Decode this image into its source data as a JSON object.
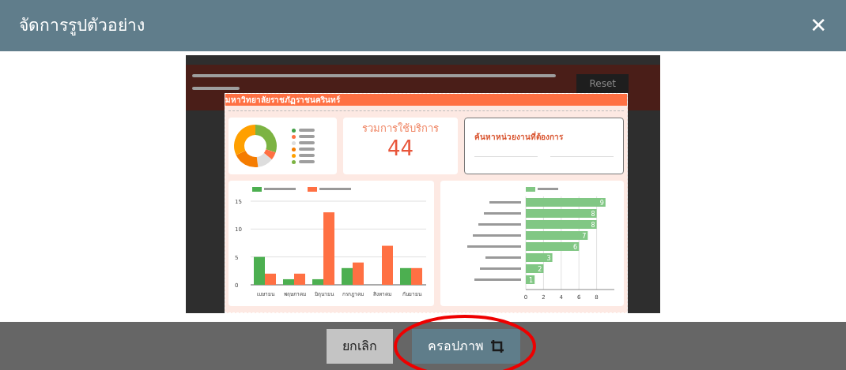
{
  "dialog": {
    "title": "จัดการรูปตัวอย่าง",
    "close": "✕"
  },
  "preview": {
    "top_button": "Reset",
    "crop_header": "มหาวิทยาลัยราชภัฏราชนครินทร์",
    "donut_legend": [
      {
        "color": "#43a047"
      },
      {
        "color": "#ff7043"
      },
      {
        "color": "#dddddd"
      },
      {
        "color": "#f57c00"
      },
      {
        "color": "#ffa000"
      },
      {
        "color": "#7cb342"
      }
    ],
    "total_card": {
      "label": "รวมการใช้บริการ",
      "value": "44"
    },
    "search_card": {
      "label": "ค้นหาหน่วยงานที่ต้องการ"
    },
    "monthly_chart": {
      "chart_data": {
        "type": "bar",
        "categories": [
          "เมษายน",
          "พฤษภาคม",
          "มิถุนายน",
          "กรกฎาคม",
          "สิงหาคม",
          "กันยายน"
        ],
        "ylim": [
          0,
          15
        ],
        "yticks": [
          0,
          5,
          10,
          15
        ],
        "grid": true,
        "series": [
          {
            "color": "#4caf50",
            "values": [
              5,
              1,
              1,
              3,
              0,
              3
            ]
          },
          {
            "color": "#ff7043",
            "values": [
              2,
              2,
              13,
              4,
              7,
              3
            ]
          }
        ]
      }
    },
    "unit_chart": {
      "chart_data": {
        "type": "bar",
        "orientation": "horizontal",
        "xlim": [
          0,
          10
        ],
        "xticks": [
          0,
          2,
          4,
          6,
          8
        ],
        "grid": true,
        "data_labels": true,
        "series": [
          {
            "color": "#81c784",
            "values": [
              9,
              8,
              8,
              7,
              6,
              3,
              2,
              1
            ]
          }
        ]
      }
    }
  },
  "footer": {
    "buttons": [
      {
        "label": "ยกเลิก",
        "kind": "cancel",
        "highlighted": false
      },
      {
        "label": "ครอปภาพ",
        "kind": "crop",
        "highlighted": true
      }
    ]
  }
}
